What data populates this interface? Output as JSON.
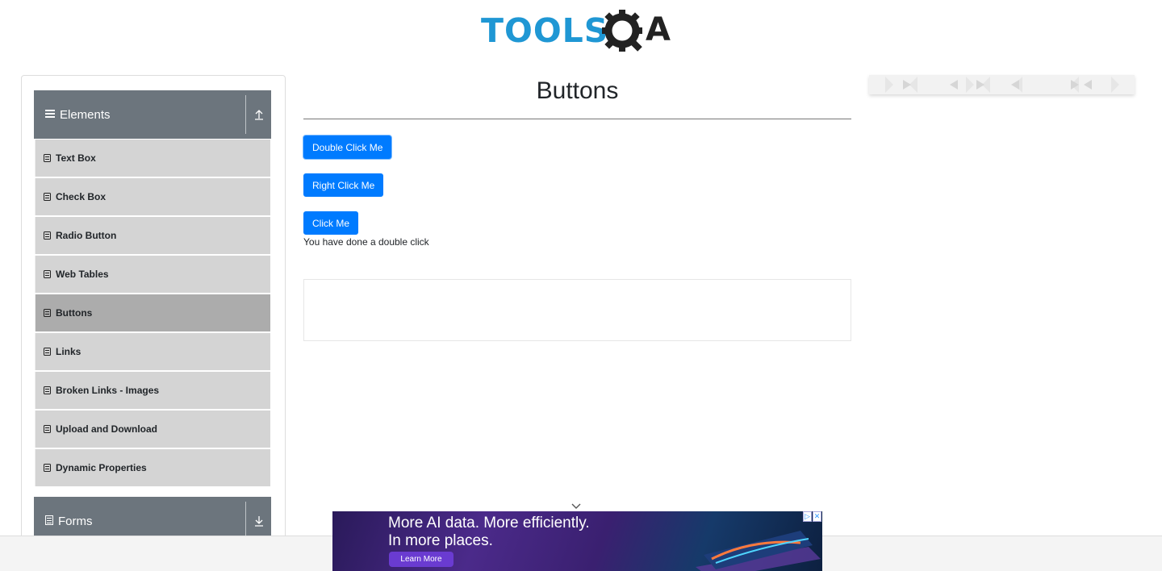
{
  "header": {
    "logo_text": "TOOLS",
    "logo_suffix": "A"
  },
  "sidebar": {
    "elements_group": "Elements",
    "forms_group": "Forms",
    "items": [
      {
        "label": "Text Box"
      },
      {
        "label": "Check Box"
      },
      {
        "label": "Radio Button"
      },
      {
        "label": "Web Tables"
      },
      {
        "label": "Buttons",
        "active": true
      },
      {
        "label": "Links"
      },
      {
        "label": "Broken Links - Images"
      },
      {
        "label": "Upload and Download"
      },
      {
        "label": "Dynamic Properties"
      }
    ]
  },
  "main": {
    "title": "Buttons",
    "double_click_label": "Double Click Me",
    "right_click_label": "Right Click Me",
    "click_label": "Click Me",
    "message": "You have done a double click"
  },
  "ad": {
    "line1": "More AI data. More efficiently.",
    "line2": "In more places.",
    "cta": "Learn More"
  },
  "colors": {
    "accent": "#007bff",
    "sidebar_header": "#6c757d",
    "menu_bg": "#d4d4d4",
    "menu_active": "#acacac",
    "logo": "#1f97d4"
  }
}
